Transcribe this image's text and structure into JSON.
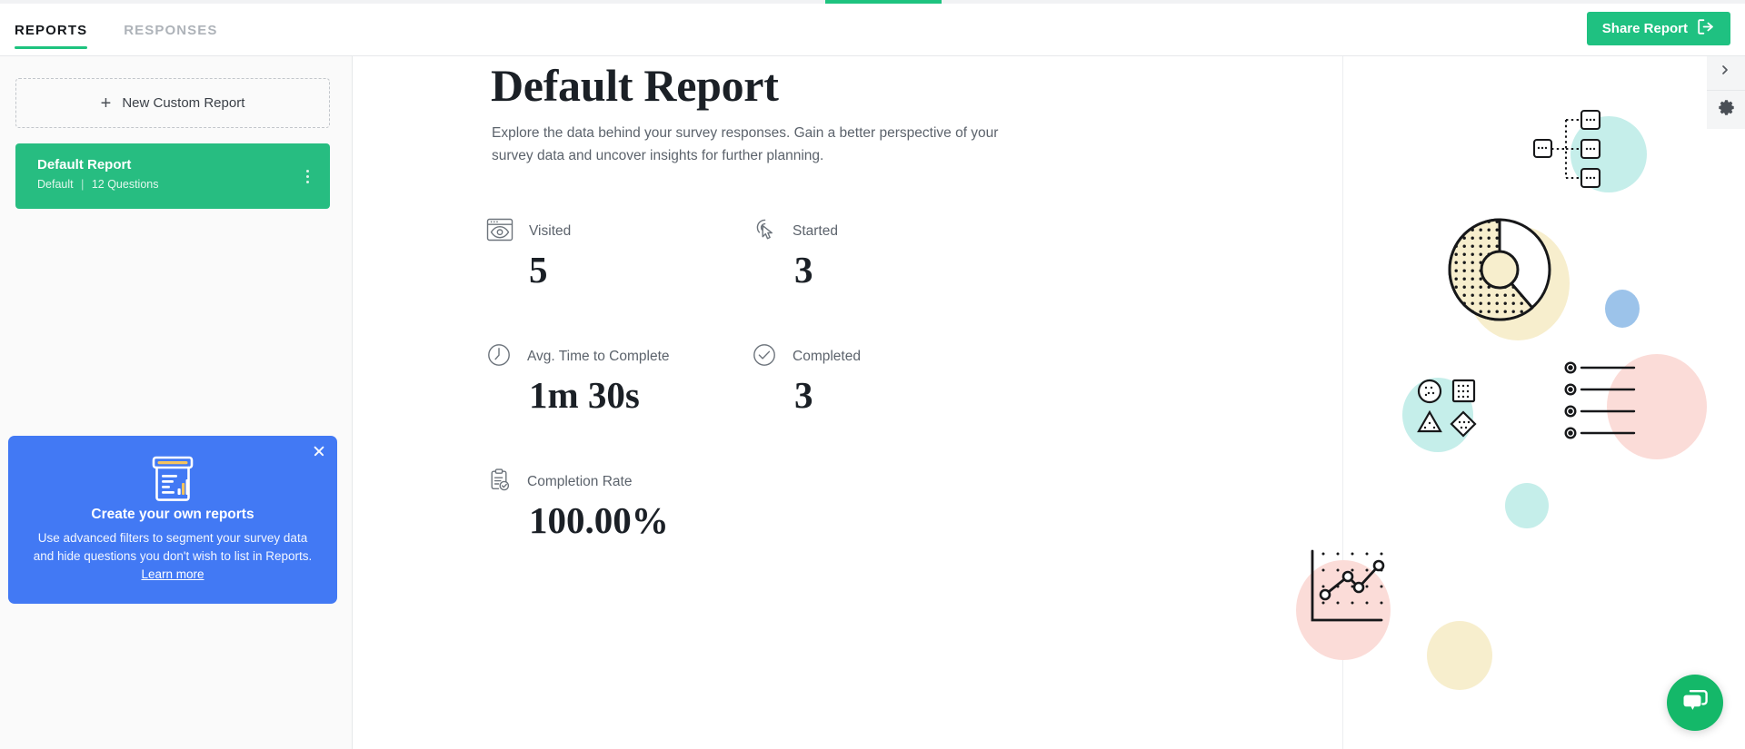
{
  "header": {
    "tabs": [
      {
        "label": "REPORTS",
        "active": true
      },
      {
        "label": "RESPONSES",
        "active": false
      }
    ],
    "share_button": {
      "label": "Share Report",
      "icon": "exit-arrow-icon"
    },
    "progress_percent": 7,
    "accent_green": "#1ec37f"
  },
  "sidebar": {
    "new_report_button": {
      "label": "New Custom Report",
      "icon": "plus-icon"
    },
    "reports": [
      {
        "title": "Default Report",
        "type": "Default",
        "separator": "|",
        "question_count": "12 Questions",
        "active": true,
        "menu_icon": "kebab-menu-icon"
      }
    ],
    "promo": {
      "icon": "report-dashboard-icon",
      "close_icon": "close-icon",
      "title": "Create your own reports",
      "body": "Use advanced filters to segment your survey data and hide questions you don't wish to list in Reports.",
      "link_label": "Learn more",
      "background_color": "#4279f4"
    }
  },
  "main": {
    "title": "Default Report",
    "description": "Explore the data behind your survey responses. Gain a better perspective of your survey data and uncover insights for further planning.",
    "stats": [
      {
        "label": "Visited",
        "value": "5",
        "icon": "browser-eye-icon"
      },
      {
        "label": "Started",
        "value": "3",
        "icon": "click-cursor-icon"
      },
      {
        "label": "Avg. Time to Complete",
        "value": "1m 30s",
        "icon": "clock-icon"
      },
      {
        "label": "Completed",
        "value": "3",
        "icon": "check-circle-icon"
      },
      {
        "label": "Completion Rate",
        "value": "100.00%",
        "icon": "clipboard-check-icon"
      }
    ]
  },
  "decor": {
    "blob_mint": "#c5eeea",
    "blob_cream": "#f7eecd",
    "blob_blue": "#9cc3ea",
    "blob_pink": "#fbdcd8",
    "glyphs": [
      "sitemap-icon",
      "donut-chart-icon",
      "shapes-icon",
      "list-icon",
      "line-chart-icon"
    ]
  },
  "rail": {
    "items": [
      {
        "icon": "chevron-icon",
        "label": ""
      },
      {
        "icon": "gear-icon",
        "label": ""
      }
    ]
  },
  "chat": {
    "icon": "chat-bubbles-icon",
    "color": "#14b869"
  }
}
